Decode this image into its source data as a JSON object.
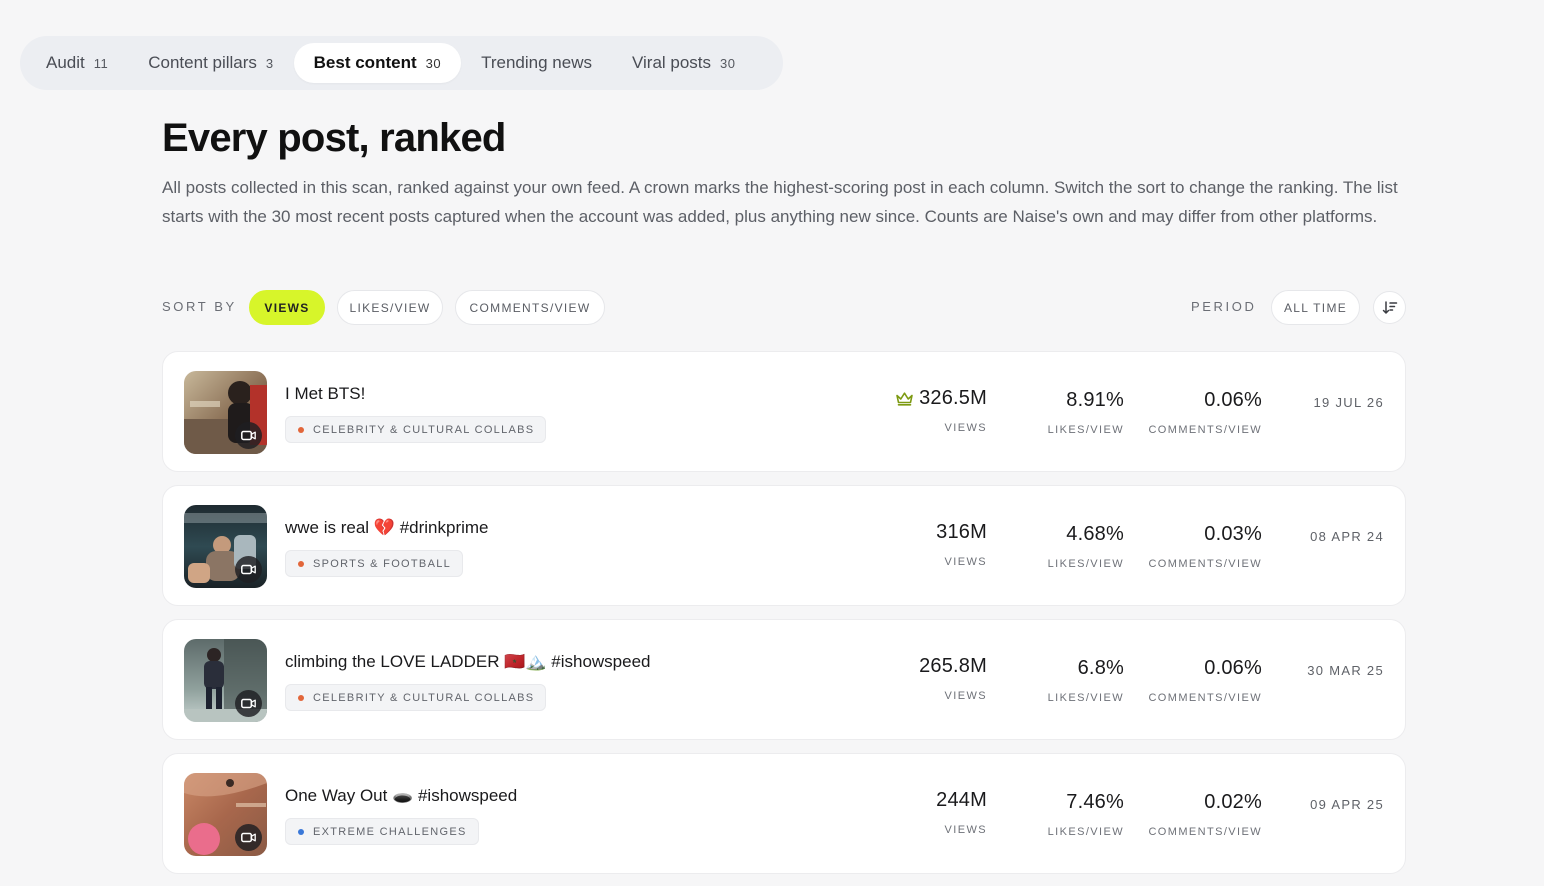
{
  "tabs": [
    {
      "label": "Audit",
      "count": "11"
    },
    {
      "label": "Content pillars",
      "count": "3"
    },
    {
      "label": "Best content",
      "count": "30"
    },
    {
      "label": "Trending news",
      "count": ""
    },
    {
      "label": "Viral posts",
      "count": "30"
    }
  ],
  "active_tab": "Best content",
  "page": {
    "title": "Every post, ranked",
    "description": "All posts collected in this scan, ranked against your own feed. A crown marks the highest-scoring post in each column. Switch the sort to change the ranking. The list starts with the 30 most recent posts captured when the account was added, plus anything new since. Counts are Naise's own and may differ from other platforms."
  },
  "sort": {
    "label": "SORT BY",
    "options": [
      "VIEWS",
      "LIKES/VIEW",
      "COMMENTS/VIEW"
    ],
    "selected": "VIEWS"
  },
  "period": {
    "label": "PERIOD",
    "value": "ALL TIME"
  },
  "colors": {
    "accent": "#d7f52a",
    "crown": "#7d9a12",
    "tag_orange": "#e2663a",
    "tag_blue": "#3a78d8"
  },
  "posts": [
    {
      "title": "I Met BTS!",
      "tag": "CELEBRITY & CULTURAL COLLABS",
      "tag_color": "#e2663a",
      "views": "326.5M",
      "views_label": "VIEWS",
      "likes_per_view": "8.91%",
      "likes_label": "LIKES/VIEW",
      "comments_per_view": "0.06%",
      "comments_label": "COMMENTS/VIEW",
      "date": "19 JUL 26",
      "crown": true,
      "icon": "video-camera-icon"
    },
    {
      "title": "wwe is real 💔 #drinkprime",
      "tag": "SPORTS & FOOTBALL",
      "tag_color": "#e2663a",
      "views": "316M",
      "views_label": "VIEWS",
      "likes_per_view": "4.68%",
      "likes_label": "LIKES/VIEW",
      "comments_per_view": "0.03%",
      "comments_label": "COMMENTS/VIEW",
      "date": "08 APR 24",
      "crown": false,
      "icon": "video-camera-icon"
    },
    {
      "title": "climbing the LOVE LADDER 🇲🇦🏔️ #ishowspeed",
      "tag": "CELEBRITY & CULTURAL COLLABS",
      "tag_color": "#e2663a",
      "views": "265.8M",
      "views_label": "VIEWS",
      "likes_per_view": "6.8%",
      "likes_label": "LIKES/VIEW",
      "comments_per_view": "0.06%",
      "comments_label": "COMMENTS/VIEW",
      "date": "30 MAR 25",
      "crown": false,
      "icon": "video-camera-icon"
    },
    {
      "title": "One Way Out 🕳️ #ishowspeed",
      "tag": "EXTREME CHALLENGES",
      "tag_color": "#3a78d8",
      "views": "244M",
      "views_label": "VIEWS",
      "likes_per_view": "7.46%",
      "likes_label": "LIKES/VIEW",
      "comments_per_view": "0.02%",
      "comments_label": "COMMENTS/VIEW",
      "date": "09 APR 25",
      "crown": false,
      "icon": "video-camera-icon"
    }
  ]
}
